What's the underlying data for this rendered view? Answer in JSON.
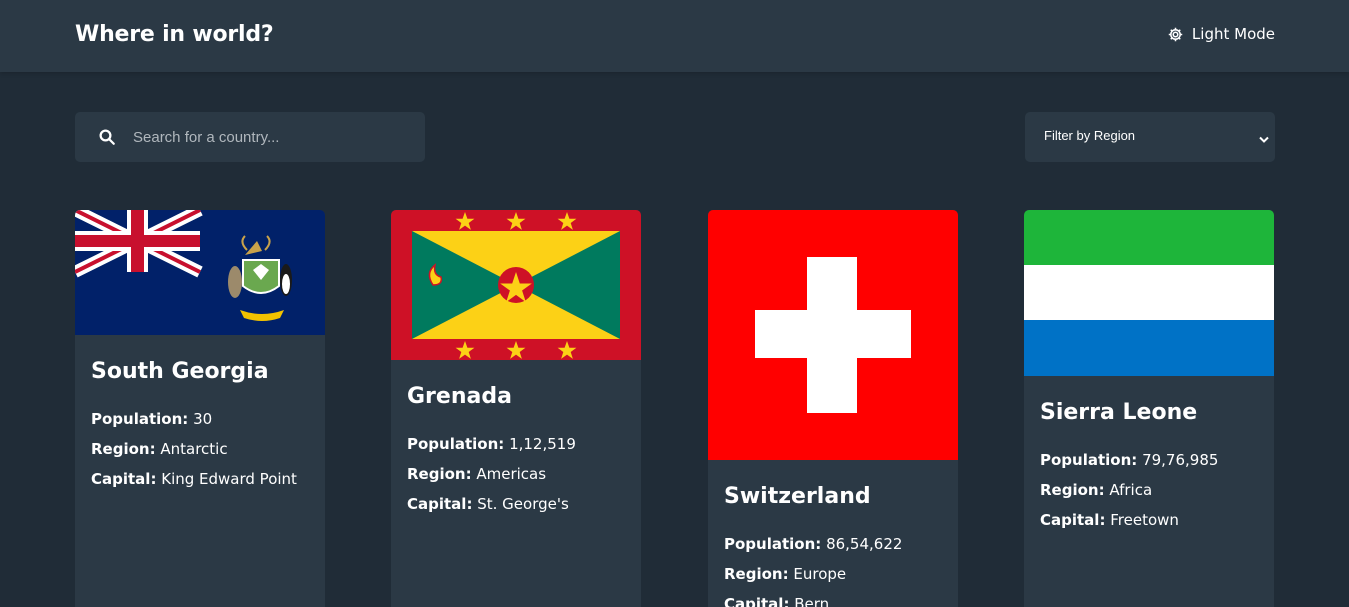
{
  "header": {
    "title": "Where in world?",
    "mode_toggle_label": "Light Mode"
  },
  "search": {
    "placeholder": "Search for a country...",
    "value": ""
  },
  "filter": {
    "selected_label": "Filter by Region"
  },
  "labels": {
    "population": "Population:",
    "region": "Region:",
    "capital": "Capital:"
  },
  "countries": [
    {
      "name": "South Georgia",
      "population": "30",
      "region": "Antarctic",
      "capital": "King Edward Point",
      "flag": "south-georgia-flag"
    },
    {
      "name": "Grenada",
      "population": "1,12,519",
      "region": "Americas",
      "capital": "St. George's",
      "flag": "grenada-flag"
    },
    {
      "name": "Switzerland",
      "population": "86,54,622",
      "region": "Europe",
      "capital": "Bern",
      "flag": "switzerland-flag"
    },
    {
      "name": "Sierra Leone",
      "population": "79,76,985",
      "region": "Africa",
      "capital": "Freetown",
      "flag": "sierra-leone-flag"
    }
  ],
  "colors": {
    "background": "#202c37",
    "element": "#2b3945",
    "text": "#ffffff"
  }
}
